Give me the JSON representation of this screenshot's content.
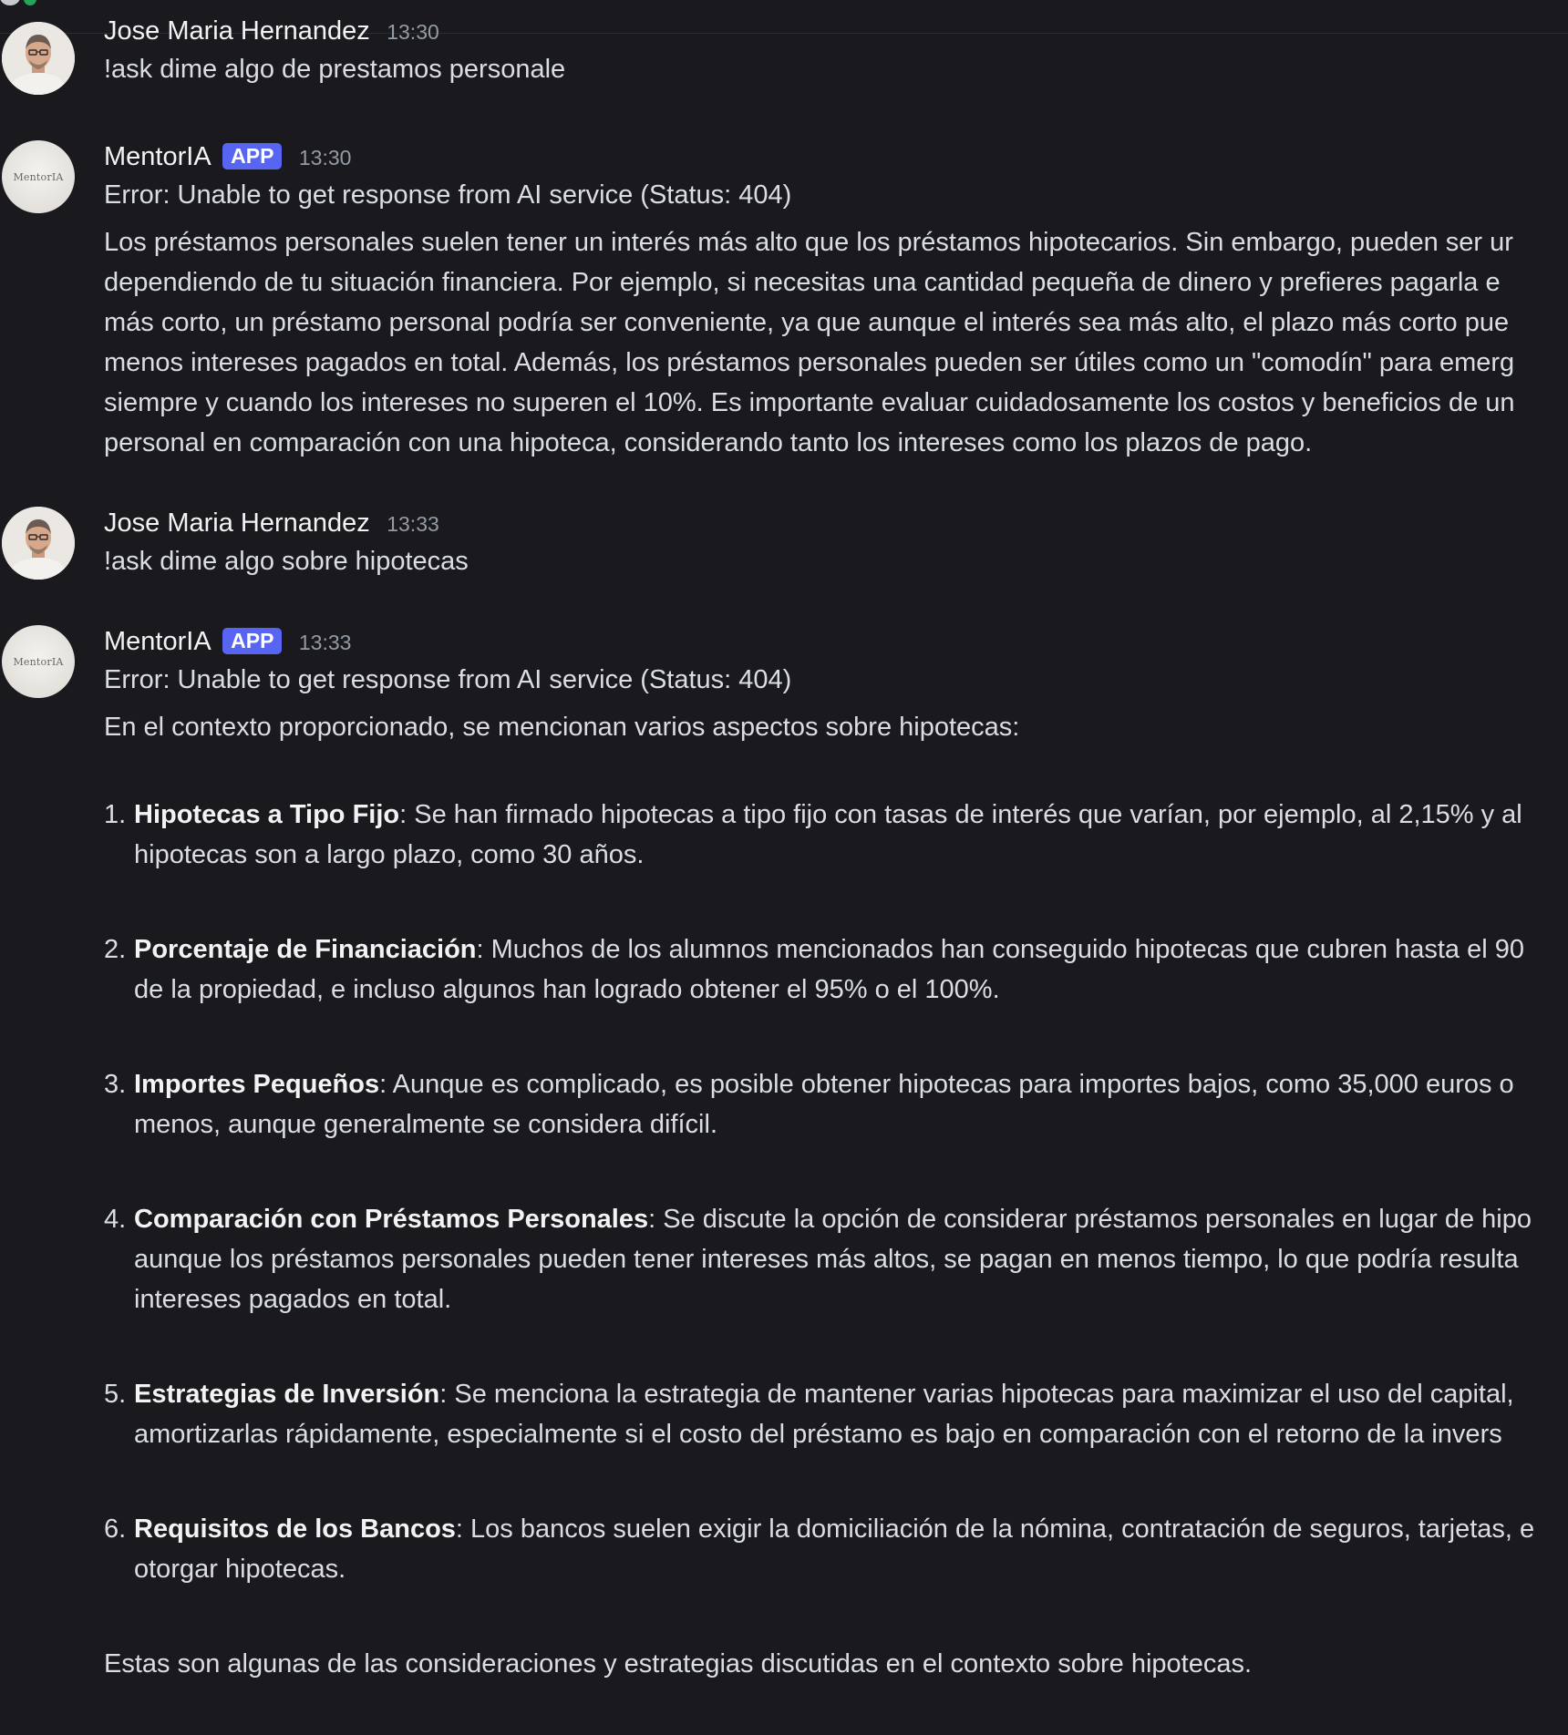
{
  "messages": {
    "m1": {
      "author": "Jose Maria Hernandez",
      "time": "13:30",
      "text": "!ask dime algo de prestamos personale"
    },
    "m2": {
      "author": "MentorIA",
      "badge": "APP",
      "time": "13:30",
      "avatar_text": "MentorIA",
      "error": "Error: Unable to get response from AI service (Status: 404)",
      "lines": [
        "Los préstamos personales suelen tener un interés más alto que los préstamos hipotecarios. Sin embargo, pueden ser ur",
        "dependiendo de tu situación financiera. Por ejemplo, si necesitas una cantidad pequeña de dinero y prefieres pagarla e",
        "más corto, un préstamo personal podría ser conveniente, ya que aunque el interés sea más alto, el plazo más corto pue",
        "menos intereses pagados en total. Además, los préstamos personales pueden ser útiles como un \"comodín\" para emerg",
        "siempre y cuando los intereses no superen el 10%. Es importante evaluar cuidadosamente los costos y beneficios de un",
        "personal en comparación con una hipoteca, considerando tanto los intereses como los plazos de pago."
      ]
    },
    "m3": {
      "author": "Jose Maria Hernandez",
      "time": "13:33",
      "text": "!ask dime algo sobre hipotecas"
    },
    "m4": {
      "author": "MentorIA",
      "badge": "APP",
      "time": "13:33",
      "avatar_text": "MentorIA",
      "error": "Error: Unable to get response from AI service (Status: 404)",
      "intro": "En el contexto proporcionado, se mencionan varios aspectos sobre hipotecas:",
      "items": [
        {
          "num": "1.",
          "term": "Hipotecas a Tipo Fijo",
          "first": ": Se han firmado hipotecas a tipo fijo con tasas de interés que varían, por ejemplo, al 2,15% y al",
          "rest": [
            "hipotecas son a largo plazo, como 30 años."
          ]
        },
        {
          "num": "2.",
          "term": "Porcentaje de Financiación",
          "first": ": Muchos de los alumnos mencionados han conseguido hipotecas que cubren hasta el 90",
          "rest": [
            "de la propiedad, e incluso algunos han logrado obtener el 95% o el 100%."
          ]
        },
        {
          "num": "3.",
          "term": "Importes Pequeños",
          "first": ": Aunque es complicado, es posible obtener hipotecas para importes bajos, como 35,000 euros o",
          "rest": [
            "menos, aunque generalmente se considera difícil."
          ]
        },
        {
          "num": "4.",
          "term": "Comparación con Préstamos Personales",
          "first": ": Se discute la opción de considerar préstamos personales en lugar de hipo",
          "rest": [
            "aunque los préstamos personales pueden tener intereses más altos, se pagan en menos tiempo, lo que podría resulta",
            "intereses pagados en total."
          ]
        },
        {
          "num": "5.",
          "term": "Estrategias de Inversión",
          "first": ": Se menciona la estrategia de mantener varias hipotecas para maximizar el uso del capital,",
          "rest": [
            "amortizarlas rápidamente, especialmente si el costo del préstamo es bajo en comparación con el retorno de la invers"
          ]
        },
        {
          "num": "6.",
          "term": "Requisitos de los Bancos",
          "first": ": Los bancos suelen exigir la domiciliación de la nómina, contratación de seguros, tarjetas, e",
          "rest": [
            "otorgar hipotecas."
          ]
        }
      ],
      "closing": "Estas son algunas de las consideraciones y estrategias discutidas en el contexto sobre hipotecas."
    }
  }
}
